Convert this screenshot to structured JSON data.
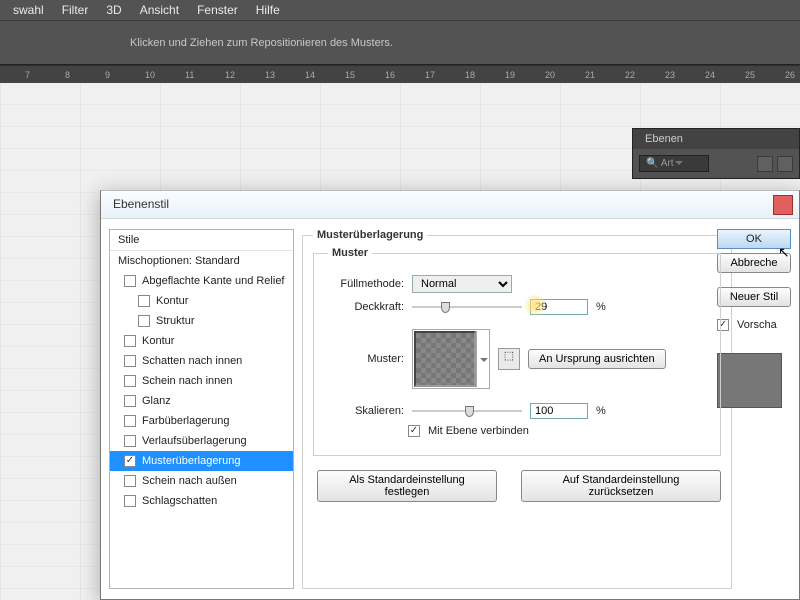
{
  "menu": {
    "items": [
      "swahl",
      "Filter",
      "3D",
      "Ansicht",
      "Fenster",
      "Hilfe"
    ]
  },
  "toolbar": {
    "hint": "Klicken und Ziehen zum Repositionieren des Musters."
  },
  "ruler": {
    "marks": [
      "7",
      "8",
      "9",
      "10",
      "11",
      "12",
      "13",
      "14",
      "15",
      "16",
      "17",
      "18",
      "19",
      "20",
      "21",
      "22",
      "23",
      "24",
      "25",
      "26"
    ]
  },
  "panel": {
    "title": "Ebenen",
    "kind": "Art"
  },
  "dialog": {
    "title": "Ebenenstil",
    "styles_hdr": "Stile",
    "items": [
      {
        "label": "Mischoptionen: Standard",
        "checked": null
      },
      {
        "label": "Abgeflachte Kante und Relief",
        "checked": false
      },
      {
        "label": "Kontur",
        "checked": false,
        "sub": true
      },
      {
        "label": "Struktur",
        "checked": false,
        "sub": true
      },
      {
        "label": "Kontur",
        "checked": false
      },
      {
        "label": "Schatten nach innen",
        "checked": false
      },
      {
        "label": "Schein nach innen",
        "checked": false
      },
      {
        "label": "Glanz",
        "checked": false
      },
      {
        "label": "Farbüberlagerung",
        "checked": false
      },
      {
        "label": "Verlaufsüberlagerung",
        "checked": false
      },
      {
        "label": "Musterüberlagerung",
        "checked": true,
        "sel": true
      },
      {
        "label": "Schein nach außen",
        "checked": false
      },
      {
        "label": "Schlagschatten",
        "checked": false
      }
    ],
    "group_outer": "Musterüberlagerung",
    "group_inner": "Muster",
    "fill_lbl": "Füllmethode:",
    "fill_val": "Normal",
    "opac_lbl": "Deckkraft:",
    "opac_val": "29",
    "pattern_lbl": "Muster:",
    "origin_btn": "An Ursprung ausrichten",
    "scale_lbl": "Skalieren:",
    "scale_val": "100",
    "pct": "%",
    "link_lbl": "Mit Ebene verbinden",
    "set_default": "Als Standardeinstellung festlegen",
    "reset_default": "Auf Standardeinstellung zurücksetzen",
    "ok": "OK",
    "cancel": "Abbreche",
    "newstyle": "Neuer Stil",
    "preview": "Vorscha"
  }
}
